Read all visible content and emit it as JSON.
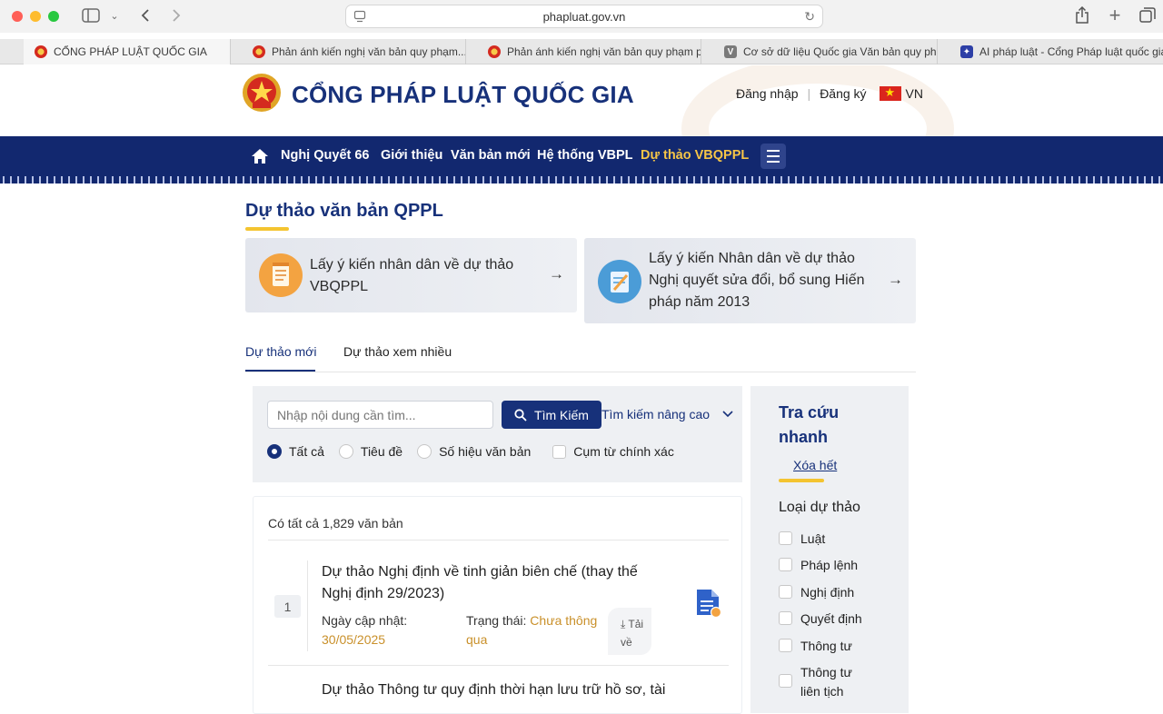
{
  "browser": {
    "url": "phapluat.gov.vn",
    "tabs": [
      {
        "label": "CỔNG PHÁP LUẬT QUỐC GIA",
        "favicon": "emblem-icon"
      },
      {
        "label": "Phản ánh kiến nghị văn bản quy phạm...",
        "favicon": "emblem-icon"
      },
      {
        "label": "Phản ánh kiến nghị văn bản quy phạm p...",
        "favicon": "emblem-icon"
      },
      {
        "label": "Cơ sở dữ liệu Quốc gia Văn bản quy phạ...",
        "favicon": "v-icon"
      },
      {
        "label": "AI pháp luật - Cổng Pháp luật quốc gia...",
        "favicon": "ai-icon"
      }
    ],
    "favicon_letters": {
      "v": "V",
      "ai": "✦"
    }
  },
  "header": {
    "site_title": "CỔNG PHÁP LUẬT QUỐC GIA",
    "login": "Đăng nhập",
    "register": "Đăng ký",
    "language": "VN"
  },
  "nav": {
    "items": [
      "Nghị Quyết 66",
      "Giới thiệu",
      "Văn bản mới",
      "Hệ thống VBPL",
      "Dự thảo VBQPPL"
    ],
    "active": "Dự thảo VBQPPL"
  },
  "page": {
    "title": "Dự thảo văn bản QPPL",
    "cards": [
      {
        "text": "Lấy ý kiến nhân dân về dự thảo VBQPPL"
      },
      {
        "text": "Lấy ý kiến Nhân dân về dự thảo Nghị quyết sửa đổi, bổ sung Hiến pháp năm 2013"
      }
    ],
    "tabs": [
      "Dự thảo mới",
      "Dự thảo xem nhiều"
    ]
  },
  "search": {
    "placeholder": "Nhập nội dung cần tìm...",
    "button": "Tìm Kiếm",
    "advanced": "Tìm kiếm nâng cao",
    "radio_options": [
      "Tất cả",
      "Tiêu đề",
      "Số hiệu văn bản"
    ],
    "exact_phrase": "Cụm từ chính xác"
  },
  "results": {
    "count_text": "Có tất cả 1,829 văn bản",
    "items": [
      {
        "index": "1",
        "title": "Dự thảo Nghị định về tinh giản biên chế (thay thế Nghị định 29/2023)",
        "updated_label": "Ngày cập nhật:",
        "updated_value": "30/05/2025",
        "status_label": "Trạng thái:",
        "status_value": "Chưa thông qua",
        "download": "Tải về"
      },
      {
        "title": "Dự thảo Thông tư quy định thời hạn lưu trữ hồ sơ, tài"
      }
    ]
  },
  "sidebar": {
    "title": "Tra cứu nhanh",
    "clear": "Xóa hết",
    "section": "Loại dự thảo",
    "options": [
      "Luật",
      "Pháp lệnh",
      "Nghị định",
      "Quyết định",
      "Thông tư",
      "Thông tư liên tịch"
    ]
  },
  "colors": {
    "brand": "#17317a",
    "nav_bg": "#12286f",
    "accent_yellow": "#f4c430",
    "status_orange": "#c9902a"
  }
}
